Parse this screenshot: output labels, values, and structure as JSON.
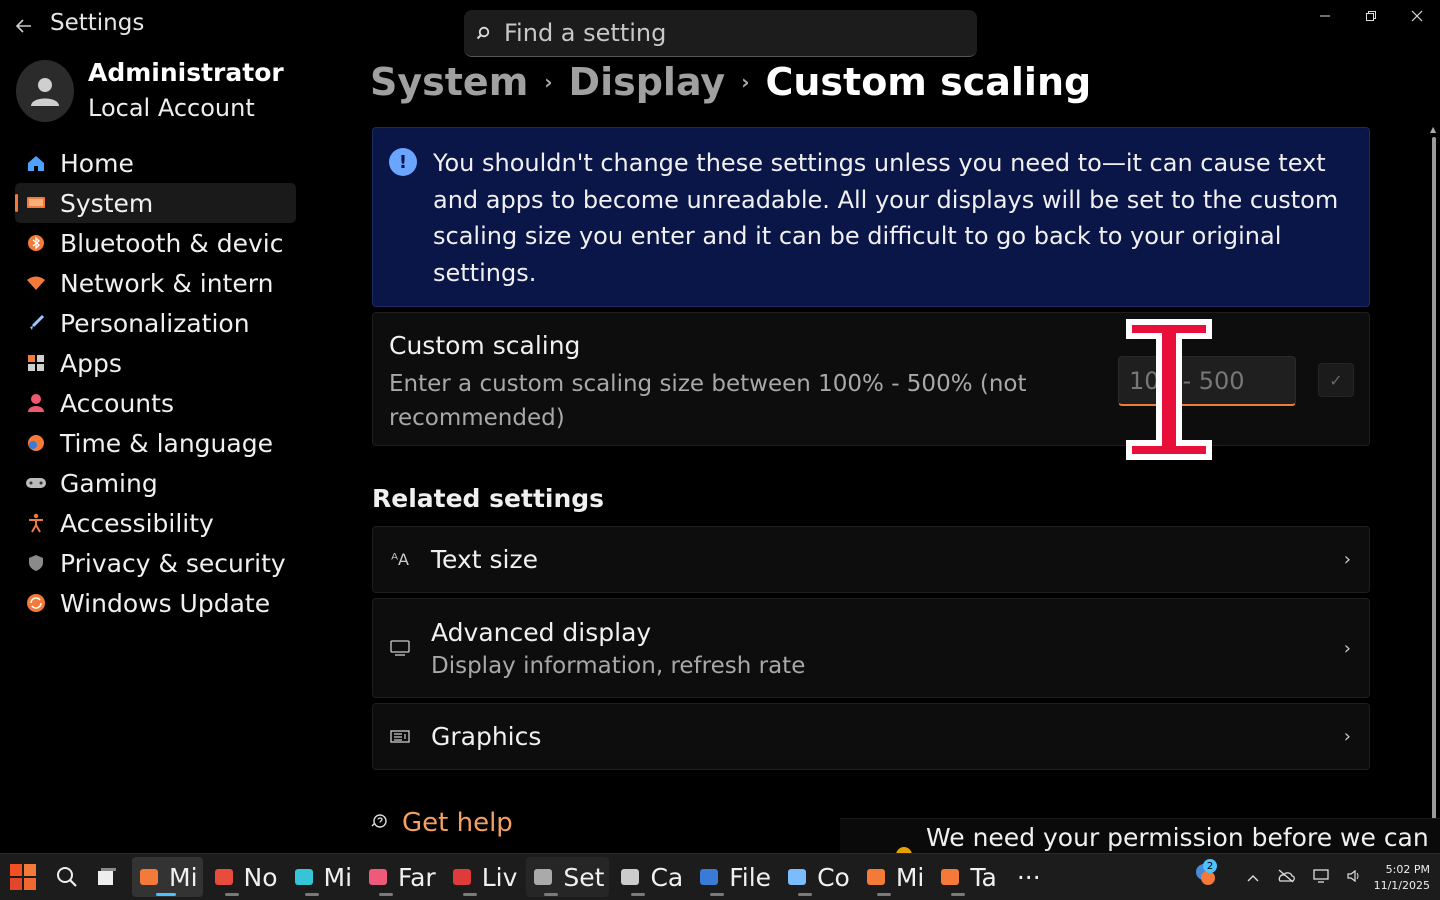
{
  "window": {
    "title": "Settings",
    "controls": {
      "minimize": "—",
      "maximize": "❐",
      "close": "✕"
    }
  },
  "search": {
    "placeholder": "Find a setting"
  },
  "profile": {
    "name": "Administrator",
    "account_type": "Local Account"
  },
  "sidebar": {
    "items": [
      {
        "label": "Home",
        "icon": "home-icon",
        "color": "#4ca3ff"
      },
      {
        "label": "System",
        "icon": "system-icon",
        "color": "#f47a3a",
        "selected": true
      },
      {
        "label": "Bluetooth & devic",
        "icon": "bluetooth-icon",
        "color": "#f47a3a"
      },
      {
        "label": "Network & intern",
        "icon": "wifi-icon",
        "color": "#f47a3a"
      },
      {
        "label": "Personalization",
        "icon": "brush-icon",
        "color": "#9ec8ff"
      },
      {
        "label": "Apps",
        "icon": "apps-icon",
        "color": "#cfcfcf"
      },
      {
        "label": "Accounts",
        "icon": "accounts-icon",
        "color": "#f0596c"
      },
      {
        "label": "Time & language",
        "icon": "clock-globe-icon",
        "color": "#f47a3a"
      },
      {
        "label": "Gaming",
        "icon": "gamepad-icon",
        "color": "#bbbbbb"
      },
      {
        "label": "Accessibility",
        "icon": "accessibility-icon",
        "color": "#f47a3a"
      },
      {
        "label": "Privacy & security",
        "icon": "shield-icon",
        "color": "#8a8a8a"
      },
      {
        "label": "Windows Update",
        "icon": "update-icon",
        "color": "#f47a3a"
      }
    ]
  },
  "breadcrumb": {
    "items": [
      "System",
      "Display"
    ],
    "current": "Custom scaling"
  },
  "infobar": {
    "message": "You shouldn't change these settings unless you need to—it can cause text and apps to become unreadable. All your displays will be set to the custom scaling size you enter and it can be difficult to go back to your original settings."
  },
  "custom_scaling": {
    "title": "Custom scaling",
    "description": "Enter a custom scaling size between 100% - 500% (not recommended)",
    "input_placeholder": "100 - 500",
    "input_value": "",
    "apply_icon": "✓"
  },
  "related": {
    "heading": "Related settings",
    "items": [
      {
        "label": "Text size",
        "sub": "",
        "icon": "text-size-icon",
        "glyph": "ᴬA"
      },
      {
        "label": "Advanced display",
        "sub": "Display information, refresh rate",
        "icon": "monitor-icon",
        "glyph": "🖵"
      },
      {
        "label": "Graphics",
        "sub": "",
        "icon": "graphics-icon",
        "glyph": "▤"
      }
    ]
  },
  "help": {
    "label": "Get help"
  },
  "toast": {
    "text": "We need your permission before we can"
  },
  "taskbar": {
    "apps": [
      {
        "label": "Mi",
        "icon": "onedrive-icon",
        "color": "#f47a3a",
        "active": true
      },
      {
        "label": "No",
        "icon": "notepad-icon",
        "color": "#e74c3c"
      },
      {
        "label": "Mi",
        "icon": "monitor-app-icon",
        "color": "#36c5d6"
      },
      {
        "label": "Far",
        "icon": "heart-icon",
        "color": "#f05a7a"
      },
      {
        "label": "Liv",
        "icon": "live-icon",
        "color": "#e03b3b"
      },
      {
        "label": "Set",
        "icon": "settings-gear-icon",
        "color": "#aaaaaa",
        "active_dim": true
      },
      {
        "label": "Ca",
        "icon": "camera-icon",
        "color": "#cccccc"
      },
      {
        "label": "File",
        "icon": "file-explorer-icon",
        "color": "#3a7bd5"
      },
      {
        "label": "Co",
        "icon": "copilot-icon",
        "color": "#7dbbff"
      },
      {
        "label": "Mi",
        "icon": "edge-icon",
        "color": "#f47a3a"
      },
      {
        "label": "Ta",
        "icon": "task-icon",
        "color": "#f47a3a"
      }
    ],
    "overflow": "···",
    "weather_badge": "2",
    "time": "5:02 PM",
    "date": "11/1/2025"
  }
}
